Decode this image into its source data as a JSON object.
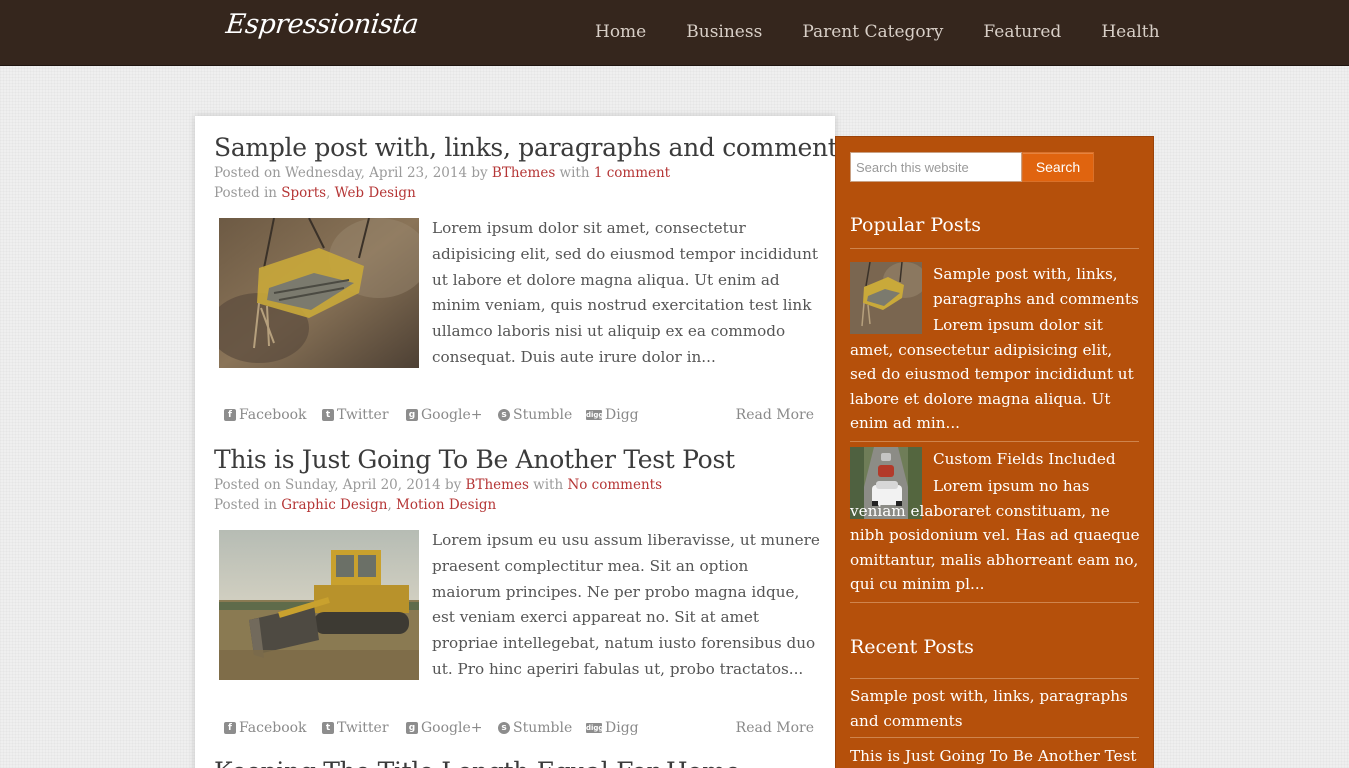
{
  "site": {
    "logo": "Espressionista"
  },
  "nav": [
    "Home",
    "Business",
    "Parent Category",
    "Featured",
    "Health"
  ],
  "posts": [
    {
      "title": "Sample post with, links, paragraphs and comments",
      "posted_prefix": "Posted on Wednesday, April 23, 2014 by ",
      "author": "BThemes",
      "with": " with ",
      "comments": "1 comment",
      "category_prefix": "Posted in ",
      "categories": [
        "Sports",
        "Web Design"
      ],
      "category_sep": ", ",
      "excerpt": "Lorem ipsum dolor sit amet, consectetur adipisicing elit, sed do eiusmod tempor incididunt ut labore et dolore magna aliqua. Ut enim ad minim veniam, quis nostrud exercitation test link ullamco laboris nisi ut aliquip ex ea commodo consequat. Duis aute irure dolor in...",
      "image": "swing-photo"
    },
    {
      "title": "This is Just Going To Be Another Test Post",
      "posted_prefix": "Posted on Sunday, April 20, 2014 by ",
      "author": "BThemes",
      "with": " with ",
      "comments": "No comments",
      "category_prefix": "Posted in ",
      "categories": [
        "Graphic Design",
        "Motion Design"
      ],
      "category_sep": ", ",
      "excerpt": "Lorem ipsum eu usu assum liberavisse, ut munere praesent complectitur mea. Sit an option maiorum principes. Ne per probo magna idque, est veniam exerci appareat no. Sit at amet propriae intellegebat, natum iusto forensibus duo ut. Pro hinc aperiri fabulas ut, probo tractatos...",
      "image": "bulldozer-photo"
    }
  ],
  "partial_third_title": "Keeping The Title Length Equal For Home",
  "share": {
    "facebook": "Facebook",
    "twitter": "Twitter",
    "google": "Google+",
    "stumble": "Stumble",
    "digg": "Digg",
    "read_more": "Read More"
  },
  "sidebar": {
    "search_placeholder": "Search this website",
    "search_button": "Search",
    "popular_title": "Popular Posts",
    "popular": [
      {
        "title": "Sample post with, links, paragraphs and comments",
        "excerpt": "Lorem ipsum dolor sit amet, consectetur adipisicing elit, sed do eiusmod tempor incididunt ut labore et dolore magna aliqua. Ut enim ad min..."
      },
      {
        "title": "Custom Fields Included",
        "excerpt": "Lorem ipsum no has veniam elaboraret constituam, ne nibh posidonium vel. Has ad quaeque omittantur, malis abhorreant eam no, qui cu minim pl..."
      }
    ],
    "recent_title": "Recent Posts",
    "recent": [
      "Sample post with, links, paragraphs and comments",
      "This is Just Going To Be Another Test Post"
    ]
  },
  "colors": {
    "header_bg": "#35261d",
    "sidebar_bg": "#b5500b",
    "link_red": "#b53636",
    "search_button": "#e0640f"
  }
}
